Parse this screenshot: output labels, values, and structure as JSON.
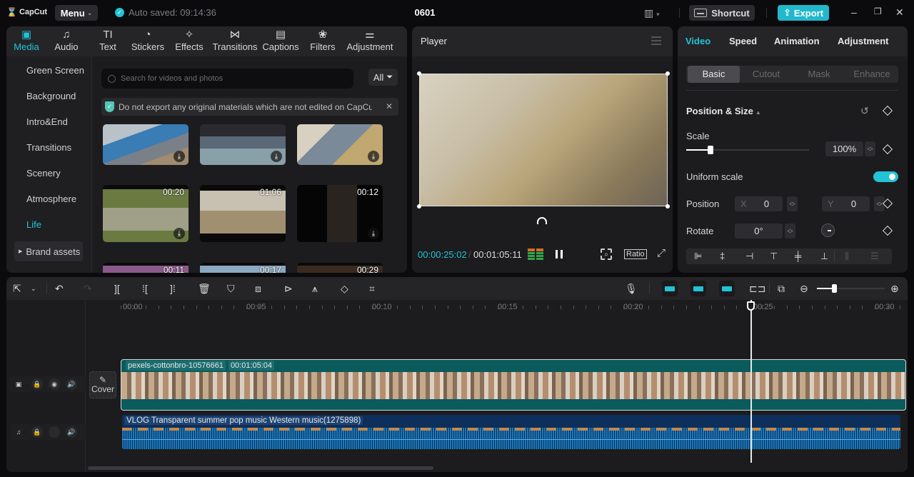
{
  "app": {
    "logo": "CapCut",
    "menu_label": "Menu",
    "autosave": "Auto saved: 09:14:36",
    "project_title": "0601",
    "shortcut_label": "Shortcut",
    "export_label": "Export",
    "accent_color": "#22c3d6"
  },
  "media_panel": {
    "tabs": [
      {
        "label": "Media",
        "icon": "▣",
        "active": true
      },
      {
        "label": "Audio",
        "icon": "♫"
      },
      {
        "label": "Text",
        "icon": "TI"
      },
      {
        "label": "Stickers",
        "icon": "◔"
      },
      {
        "label": "Effects",
        "icon": "✧"
      },
      {
        "label": "Transitions",
        "icon": "⋈"
      },
      {
        "label": "Captions",
        "icon": "▤"
      },
      {
        "label": "Filters",
        "icon": "❀"
      },
      {
        "label": "Adjustment",
        "icon": "⚌"
      }
    ],
    "nav_items": [
      "Green Screen",
      "Background",
      "Intro&End",
      "Transitions",
      "Scenery",
      "Atmosphere",
      "Life"
    ],
    "nav_active": "Life",
    "brand_assets": "Brand assets",
    "search_placeholder": "Search for videos and photos",
    "filter_label": "All",
    "notice": "Do not export any original materials which are not edited on CapCut",
    "thumbnails": [
      {
        "duration": "",
        "download": true
      },
      {
        "duration": "",
        "download": true
      },
      {
        "duration": "",
        "download": true
      },
      {
        "duration": "00:20",
        "download": true
      },
      {
        "duration": "01:06",
        "download": false
      },
      {
        "duration": "00:12",
        "download": true
      },
      {
        "duration": "00:11",
        "download": false
      },
      {
        "duration": "00:17",
        "download": false
      },
      {
        "duration": "00:29",
        "download": false
      }
    ]
  },
  "player": {
    "title": "Player",
    "current_time": "00:00:25:02",
    "separator": "/",
    "total_time": "00:01:05:11",
    "ratio_label": "Ratio"
  },
  "properties": {
    "tabs": [
      "Video",
      "Speed",
      "Animation",
      "Adjustment"
    ],
    "active_tab": "Video",
    "sub_tabs": [
      "Basic",
      "Cutout",
      "Mask",
      "Enhance"
    ],
    "active_sub_tab": "Basic",
    "section_title": "Position & Size",
    "scale_label": "Scale",
    "scale_value": "100%",
    "scale_slider_fraction": 0.2,
    "uniform_scale_label": "Uniform scale",
    "uniform_scale_on": true,
    "position_label": "Position",
    "x_axis": "X",
    "x_value": "0",
    "y_axis": "Y",
    "y_value": "0",
    "rotate_label": "Rotate",
    "rotate_value": "0°"
  },
  "timeline": {
    "ruler": [
      "00:00",
      "00:05",
      "00:10",
      "00:15",
      "00:20",
      "00:25",
      "00:30"
    ],
    "playhead_time": "00:25",
    "cover_label": "Cover",
    "video_clip": {
      "name": "pexels-cottonbro-10576661",
      "duration": "00:01:05:04"
    },
    "audio_clip": {
      "name": "VLOG Transparent summer pop music Western music(1275898)"
    },
    "zoom_fraction": 0.25
  }
}
